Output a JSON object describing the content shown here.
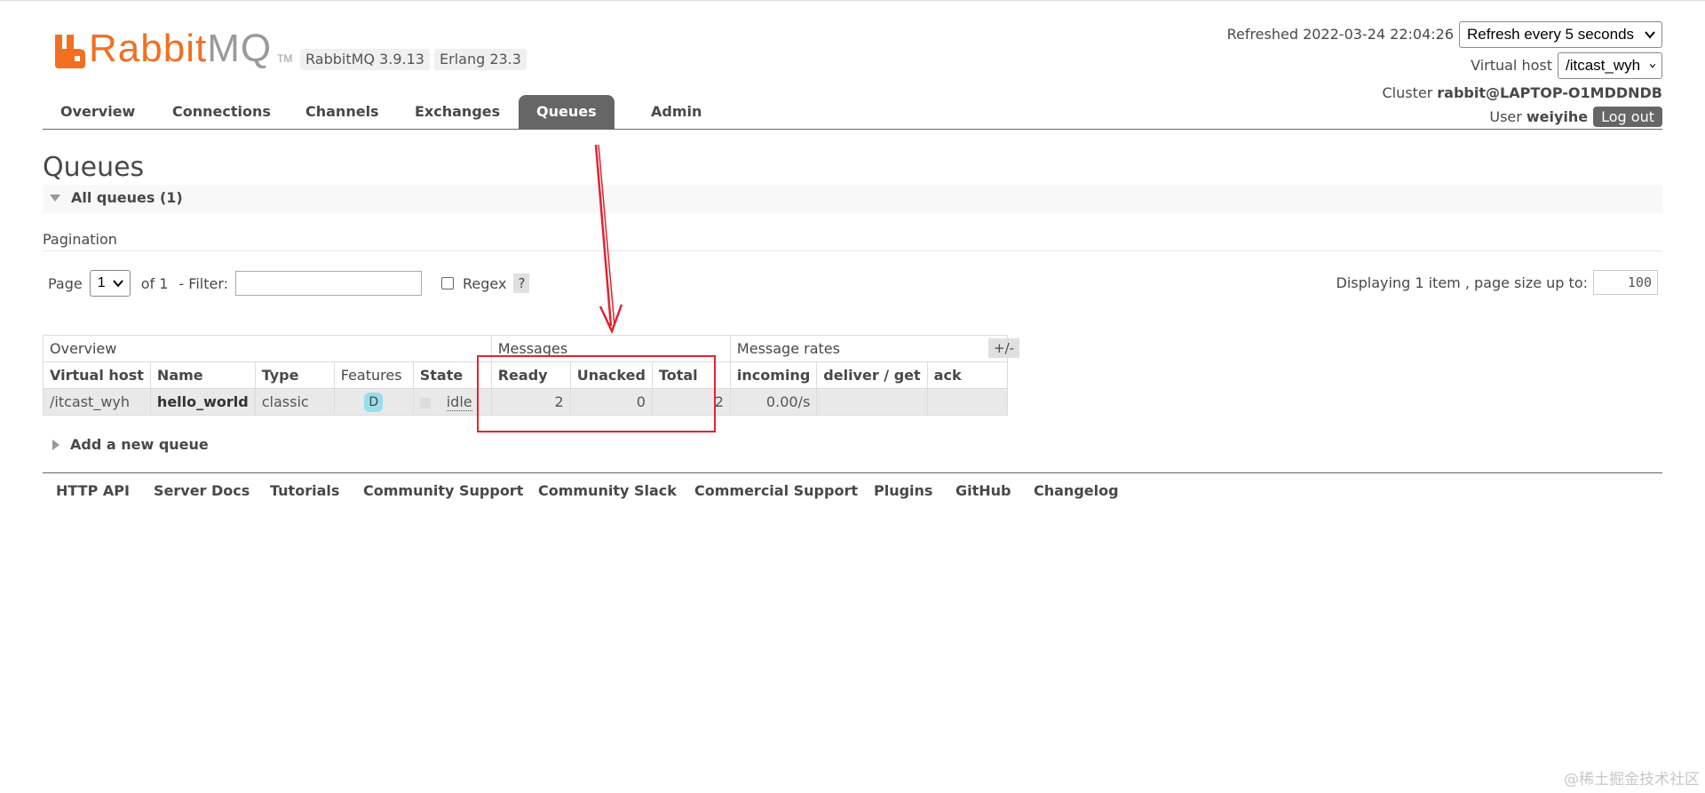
{
  "header": {
    "logo": {
      "brand": "Rabbit",
      "suffix": "MQ",
      "tm": "TM"
    },
    "versions": {
      "rabbitmq": "RabbitMQ 3.9.13",
      "erlang": "Erlang 23.3"
    },
    "refreshed": "Refreshed 2022-03-24 22:04:26",
    "refresh_select": "Refresh every 5 seconds",
    "virtual_host_label": "Virtual host",
    "virtual_host_value": "/itcast_wyh",
    "cluster_label": "Cluster",
    "cluster_value": "rabbit@LAPTOP-O1MDDNDB",
    "user_label": "User",
    "user_value": "weiyihe",
    "logout_label": "Log out"
  },
  "menu": {
    "tabs": [
      {
        "label": "Overview"
      },
      {
        "label": "Connections"
      },
      {
        "label": "Channels"
      },
      {
        "label": "Exchanges"
      },
      {
        "label": "Queues",
        "active": true
      },
      {
        "label": "Admin"
      }
    ]
  },
  "main": {
    "title": "Queues",
    "section_toggle": "All queues (1)",
    "pagination": {
      "label": "Pagination",
      "page_label": "Page",
      "page_value": "1",
      "of_label": "of 1",
      "filter_label": "- Filter:",
      "filter_value": "",
      "regex_label": "Regex",
      "help": "?",
      "display_info": "Displaying 1 item , page size up to:",
      "page_size": "100"
    },
    "table": {
      "groups": {
        "overview": "Overview",
        "messages": "Messages",
        "rates": "Message rates",
        "toggle": "+/-"
      },
      "columns": [
        "Virtual host",
        "Name",
        "Type",
        "Features",
        "State",
        "Ready",
        "Unacked",
        "Total",
        "incoming",
        "deliver / get",
        "ack"
      ],
      "rows": [
        {
          "vhost": "/itcast_wyh",
          "name": "hello_world",
          "type": "classic",
          "features": "D",
          "state": "idle",
          "ready": "2",
          "unacked": "0",
          "total": "2",
          "incoming": "0.00/s",
          "deliver_get": "",
          "ack": ""
        }
      ]
    },
    "add_queue": "Add a new queue"
  },
  "footer": {
    "links": [
      "HTTP API",
      "Server Docs",
      "Tutorials",
      "Community Support",
      "Community Slack",
      "Commercial Support",
      "Plugins",
      "GitHub",
      "Changelog"
    ]
  },
  "watermark": "@稀土掘金技术社区",
  "colors": {
    "brand": "#f26f22",
    "annotation": "#e0242e",
    "active_tab": "#666666"
  }
}
